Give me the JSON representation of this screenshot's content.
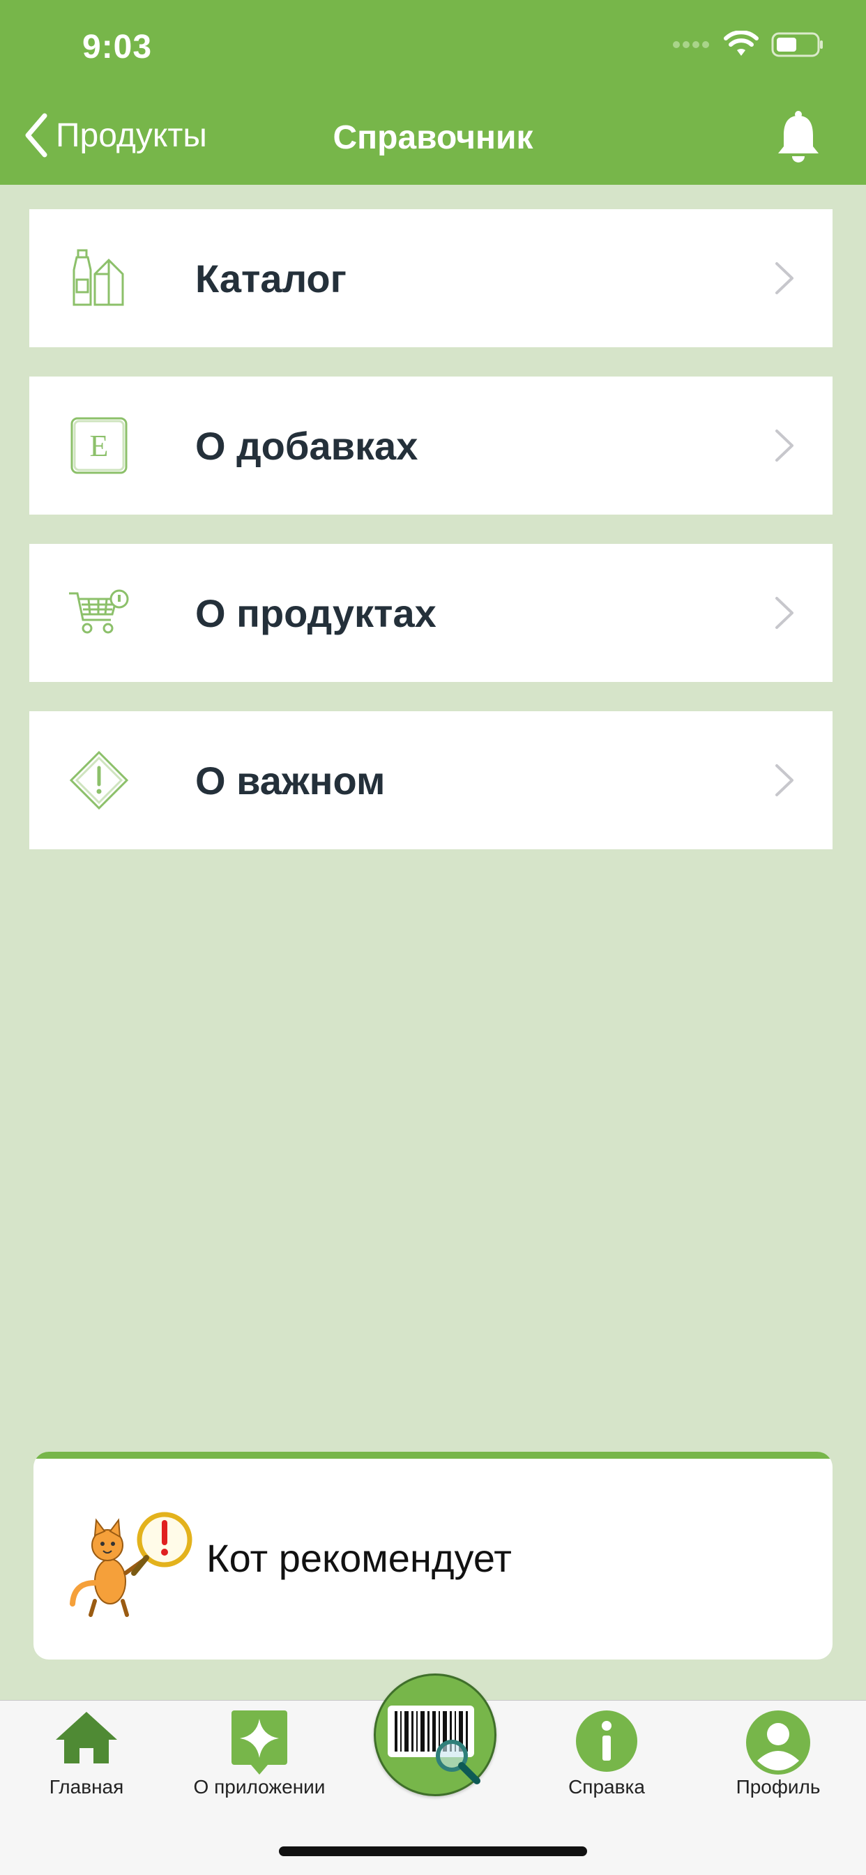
{
  "status_bar": {
    "time": "9:03"
  },
  "nav": {
    "back_label": "Продукты",
    "title": "Справочник"
  },
  "menu": [
    {
      "label": "Каталог",
      "icon": "catalog-bottles-icon"
    },
    {
      "label": "О добавках",
      "icon": "e-additive-icon"
    },
    {
      "label": "О продуктах",
      "icon": "cart-info-icon"
    },
    {
      "label": "О важном",
      "icon": "warning-diamond-icon"
    }
  ],
  "promo": {
    "label": "Кот рекомендует"
  },
  "tabs": [
    {
      "label": "Главная",
      "icon": "home-icon"
    },
    {
      "label": "О приложении",
      "icon": "app-star-icon"
    },
    {
      "label": "Справка",
      "icon": "info-icon"
    },
    {
      "label": "Профиль",
      "icon": "profile-icon"
    }
  ],
  "colors": {
    "accent": "#77b64a",
    "background": "#d6e4c9",
    "text_dark": "#24303a"
  }
}
